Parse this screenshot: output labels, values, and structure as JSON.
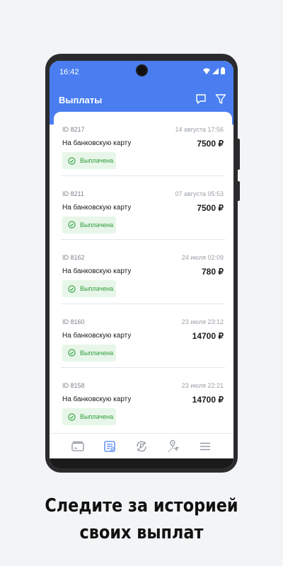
{
  "status_bar": {
    "time": "16:42"
  },
  "header": {
    "title": "Выплаты",
    "icons": [
      "chat-icon",
      "filter-icon"
    ]
  },
  "payouts": [
    {
      "id": "ID 8217",
      "date": "14 августа 17:56",
      "method": "На банковскую карту",
      "amount": "7500 ₽",
      "status": "Выплачена"
    },
    {
      "id": "ID 8211",
      "date": "07 августа 05:53",
      "method": "На банковскую карту",
      "amount": "7500 ₽",
      "status": "Выплачена"
    },
    {
      "id": "ID 8162",
      "date": "24 июля 02:09",
      "method": "На банковскую карту",
      "amount": "780 ₽",
      "status": "Выплачена"
    },
    {
      "id": "ID 8160",
      "date": "23 июля 23:12",
      "method": "На банковскую карту",
      "amount": "14700 ₽",
      "status": "Выплачена"
    },
    {
      "id": "ID 8158",
      "date": "23 июля 22:21",
      "method": "На банковскую карту",
      "amount": "14700 ₽",
      "status": "Выплачена"
    }
  ],
  "bottom_nav": {
    "items": [
      "card-icon",
      "payout-list-icon",
      "ruble-exchange-icon",
      "location-icon",
      "menu-icon"
    ],
    "active": "payout-list-icon"
  },
  "caption": {
    "line1": "Следите за историей",
    "line2": "своих выплат"
  },
  "colors": {
    "accent": "#4a7ef0",
    "success": "#2e9e3f",
    "success_bg": "#e7f6e8"
  }
}
